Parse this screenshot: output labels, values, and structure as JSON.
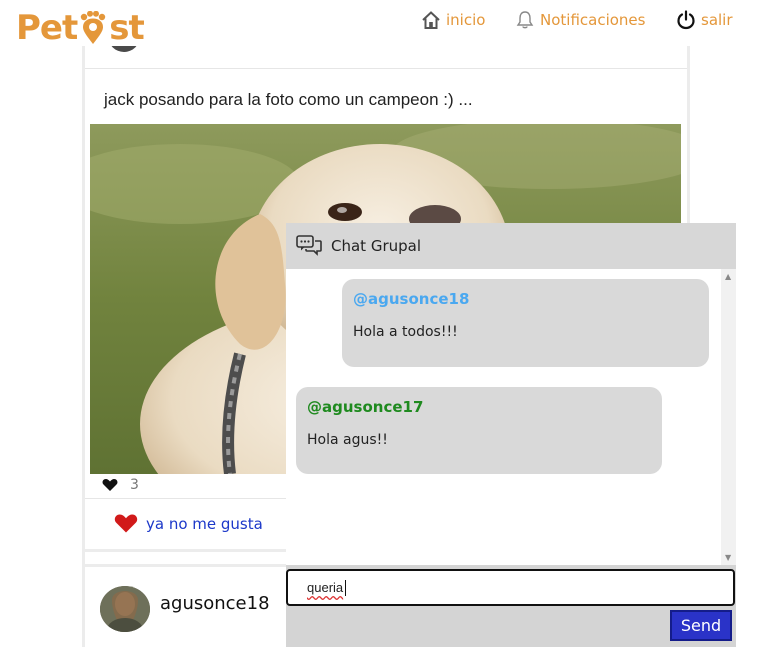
{
  "brand": {
    "name_left": "Pet",
    "name_right": "st",
    "color": "#e4973a"
  },
  "nav": {
    "home_label": "inicio",
    "notifications_label": "Notificaciones",
    "logout_label": "salir"
  },
  "post": {
    "text": "jack posando para la foto como un campeon :) ...",
    "like_count": "3",
    "unlike_label": "ya no me gusta"
  },
  "next_post": {
    "username": "agusonce18"
  },
  "chat": {
    "title": "Chat Grupal",
    "messages": [
      {
        "author": "@agusonce18",
        "text": "Hola a todos!!!",
        "author_color": "#4aa8f0"
      },
      {
        "author": "@agusonce17",
        "text": "Hola agus!!",
        "author_color": "#1f8a1f"
      }
    ],
    "input_value": "queria",
    "send_label": "Send"
  },
  "colors": {
    "accent": "#e4973a",
    "link": "#1c38c9",
    "send": "#2a33c8",
    "heart": "#d11a1a"
  }
}
